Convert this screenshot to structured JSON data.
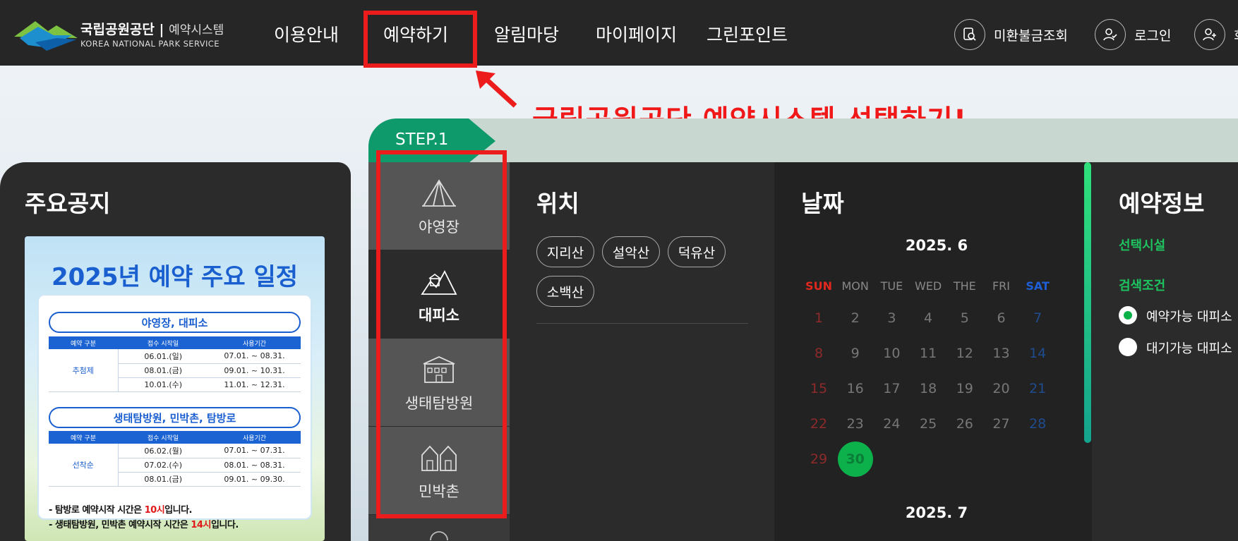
{
  "header": {
    "logo_main": "국립공원공단",
    "logo_system": "예약시스템",
    "logo_en": "KOREA NATIONAL PARK SERVICE",
    "nav": [
      "이용안내",
      "예약하기",
      "알림마당",
      "마이페이지",
      "그린포인트"
    ],
    "utils": [
      "미환불금조회",
      "로그인",
      "회"
    ]
  },
  "annotation": {
    "text": "국립공원공단 예약시스템 선택하기!",
    "color": "#ec1c1c"
  },
  "step": {
    "label": "STEP.1"
  },
  "notice": {
    "title": "주요공지",
    "poster": {
      "title": "2025년 예약 주요 일정",
      "section1": "야영장, 대피소",
      "section2": "생태탐방원, 민박촌, 탐방로",
      "columns": [
        "예약 구분",
        "접수 시작일",
        "사용기간"
      ],
      "group1": "추첨제",
      "rows1": [
        [
          "06.01.(일)",
          "07.01. ~ 08.31."
        ],
        [
          "08.01.(금)",
          "09.01. ~ 10.31."
        ],
        [
          "10.01.(수)",
          "11.01. ~ 12.31."
        ]
      ],
      "group2": "선착순",
      "rows2": [
        [
          "06.02.(월)",
          "07.01. ~ 07.31."
        ],
        [
          "07.02.(수)",
          "08.01. ~ 08.31."
        ],
        [
          "08.01.(금)",
          "09.01. ~ 09.30."
        ]
      ],
      "note1_a": "- 탐방로 예약시작 시간은 ",
      "note1_b": "10시",
      "note1_c": "입니다.",
      "note2_a": "- 생태탐방원, 민박촌 예약시작 시간은 ",
      "note2_b": "14시",
      "note2_c": "입니다."
    }
  },
  "categories": [
    {
      "label": "야영장",
      "icon": "tent-icon"
    },
    {
      "label": "대피소",
      "icon": "shelter-icon",
      "active": true
    },
    {
      "label": "생태탐방원",
      "icon": "eco-center-icon"
    },
    {
      "label": "민박촌",
      "icon": "village-icon"
    }
  ],
  "location": {
    "title": "위치",
    "chips": [
      "지리산",
      "설악산",
      "덕유산",
      "소백산"
    ]
  },
  "date": {
    "title": "날짜",
    "month1": "2025. 6",
    "month2": "2025. 7",
    "weekdays": [
      "SUN",
      "MON",
      "TUE",
      "WED",
      "THE",
      "FRI",
      "SAT"
    ],
    "selected_day": 30,
    "colors": {
      "sun": "#e0281e",
      "sat": "#1e5fd6",
      "selected": "#0db14b"
    }
  },
  "info": {
    "title": "예약정보",
    "facility_label": "선택시설",
    "search_label": "검색조건",
    "options": [
      "예약가능 대피소",
      "대기가능 대피소"
    ],
    "selected_option": 0
  }
}
